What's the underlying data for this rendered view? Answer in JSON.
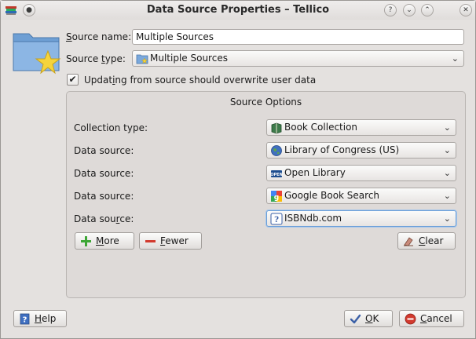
{
  "window": {
    "title": "Data Source Properties – Tellico",
    "buttons": [
      "?",
      "ˇ",
      "ˆ"
    ]
  },
  "form": {
    "source_name_label_pre": "",
    "source_name_label_u": "S",
    "source_name_label_post": "ource name:",
    "source_name_value": "Multiple Sources",
    "source_type_label_pre": "Source ",
    "source_type_label_u": "t",
    "source_type_label_post": "ype:",
    "source_type_value": "Multiple Sources",
    "update_label_pre": "Updat",
    "update_label_u": "i",
    "update_label_post": "ng from source should overwrite user data",
    "update_checked": "✔"
  },
  "source_options": {
    "title": "Source Options",
    "collection_type_label": "Collection type:",
    "collection_type_value": "Book Collection",
    "data_source_label_pre": "Data source:",
    "data_source_label_4_pre": "Data sou",
    "data_source_label_4_u": "r",
    "data_source_label_4_post": "ce:",
    "sources": [
      "Library of Congress (US)",
      "Open Library",
      "Google Book Search",
      "ISBNdb.com"
    ],
    "more_label_u": "M",
    "more_label_post": "ore",
    "fewer_label_u": "F",
    "fewer_label_post": "ewer",
    "clear_label_u": "C",
    "clear_label_post": "lear"
  },
  "footer": {
    "help_label_u": "H",
    "help_label_post": "elp",
    "ok_label_u": "O",
    "ok_label_post": "K",
    "cancel_label_u": "C",
    "cancel_label_post": "ancel"
  },
  "colors": {
    "accent": "#6a9ed8",
    "window_bg": "#e4e1df"
  },
  "icons": {
    "app": "tellico-books-icon",
    "folder": "folder-star-icon",
    "collection": "book-icon",
    "loc": "globe-icon",
    "openlibrary": "open-library-icon",
    "google": "google-icon",
    "isbndb": "isbndb-icon"
  }
}
